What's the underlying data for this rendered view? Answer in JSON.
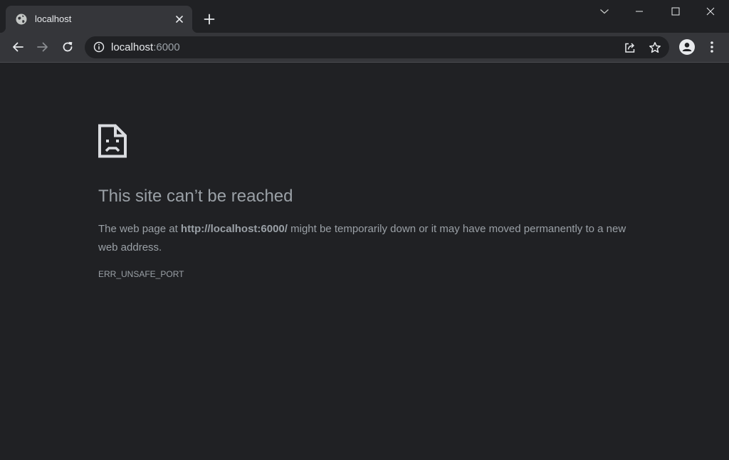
{
  "tab": {
    "title": "localhost",
    "favicon": "globe-icon",
    "close_icon": "close-icon"
  },
  "new_tab_icon": "plus-icon",
  "window_controls": {
    "tab_search": "chevron-down-icon",
    "minimize": "minimize-icon",
    "maximize": "maximize-icon",
    "close": "close-icon"
  },
  "toolbar": {
    "back_icon": "arrow-left-icon",
    "forward_icon": "arrow-right-icon",
    "reload_icon": "reload-icon",
    "site_info_icon": "info-icon",
    "url_host": "localhost",
    "url_port": ":6000",
    "share_icon": "share-icon",
    "bookmark_icon": "star-icon",
    "profile_icon": "person-icon",
    "menu_icon": "kebab-menu-icon"
  },
  "error": {
    "icon": "sad-page-icon",
    "title": "This site can’t be reached",
    "desc_before": "The web page at ",
    "desc_url": "http://localhost:6000/",
    "desc_after": " might be temporarily down or it may have moved permanently to a new web address.",
    "code": "ERR_UNSAFE_PORT"
  },
  "colors": {
    "frame": "#202124",
    "toolbar": "#35363a",
    "text": "#e8eaed",
    "muted_text": "#9aa0a6"
  }
}
